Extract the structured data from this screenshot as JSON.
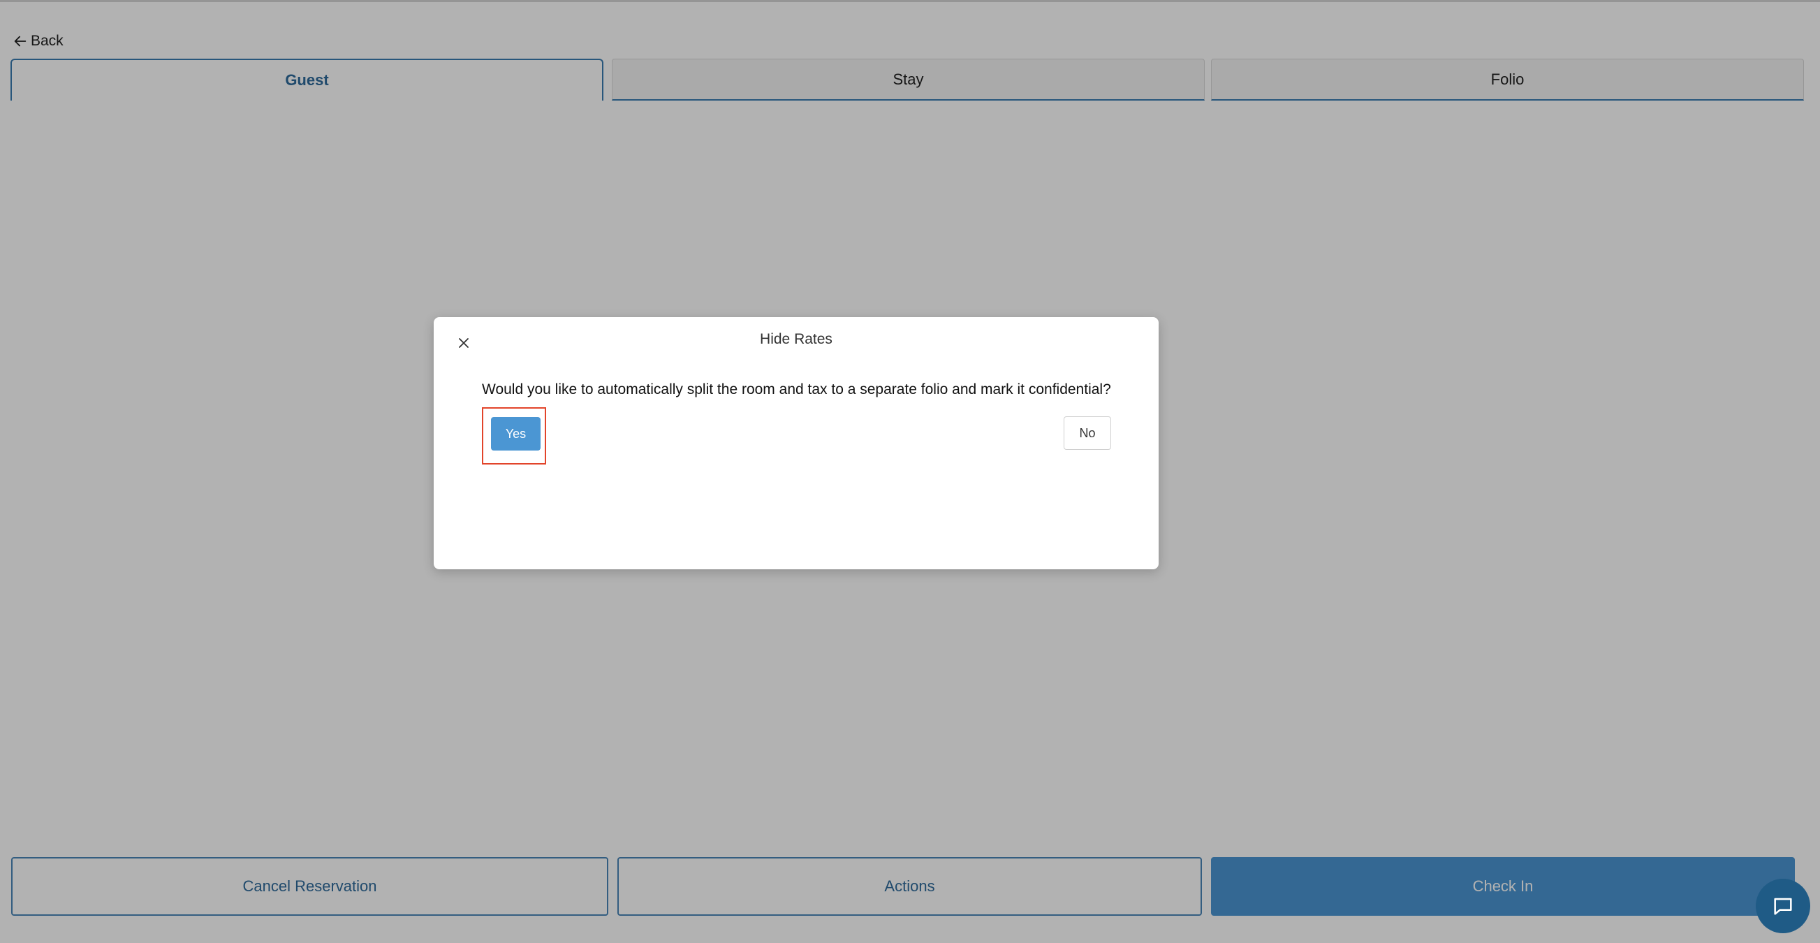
{
  "header": {
    "back_label": "Back"
  },
  "tabs": [
    {
      "label": "Guest",
      "active": true
    },
    {
      "label": "Stay",
      "active": false
    },
    {
      "label": "Folio",
      "active": false
    }
  ],
  "footer": {
    "cancel_label": "Cancel Reservation",
    "actions_label": "Actions",
    "checkin_label": "Check In"
  },
  "modal": {
    "title": "Hide Rates",
    "question": "Would you like to automatically split the room and tax to a separate folio and mark it confidential?",
    "yes_label": "Yes",
    "no_label": "No"
  },
  "icons": {
    "back": "arrow-left-icon",
    "close": "close-icon",
    "chat": "chat-icon"
  },
  "colors": {
    "accent": "#4b96d3",
    "accent_dark": "#2f6b9b",
    "highlight": "#e2442a",
    "chat_bubble": "#1f5b86"
  }
}
